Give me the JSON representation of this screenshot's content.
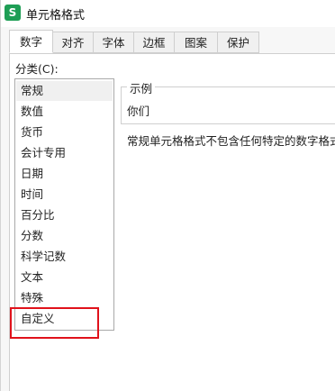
{
  "window": {
    "title": "单元格格式",
    "app_icon_letter": "S",
    "app_icon_color": "#1e9e55"
  },
  "tabs": [
    {
      "label": "数字",
      "active": true
    },
    {
      "label": "对齐",
      "active": false
    },
    {
      "label": "字体",
      "active": false
    },
    {
      "label": "边框",
      "active": false
    },
    {
      "label": "图案",
      "active": false
    },
    {
      "label": "保护",
      "active": false
    }
  ],
  "category": {
    "label": "分类(C):",
    "selected": "常规",
    "items": [
      "常规",
      "数值",
      "货币",
      "会计专用",
      "日期",
      "时间",
      "百分比",
      "分数",
      "科学记数",
      "文本",
      "特殊",
      "自定义"
    ],
    "highlighted_item": "自定义",
    "highlight_color": "#e0121b"
  },
  "sample": {
    "legend": "示例",
    "value": "你们"
  },
  "description": "常规单元格格式不包含任何特定的数字格式。"
}
